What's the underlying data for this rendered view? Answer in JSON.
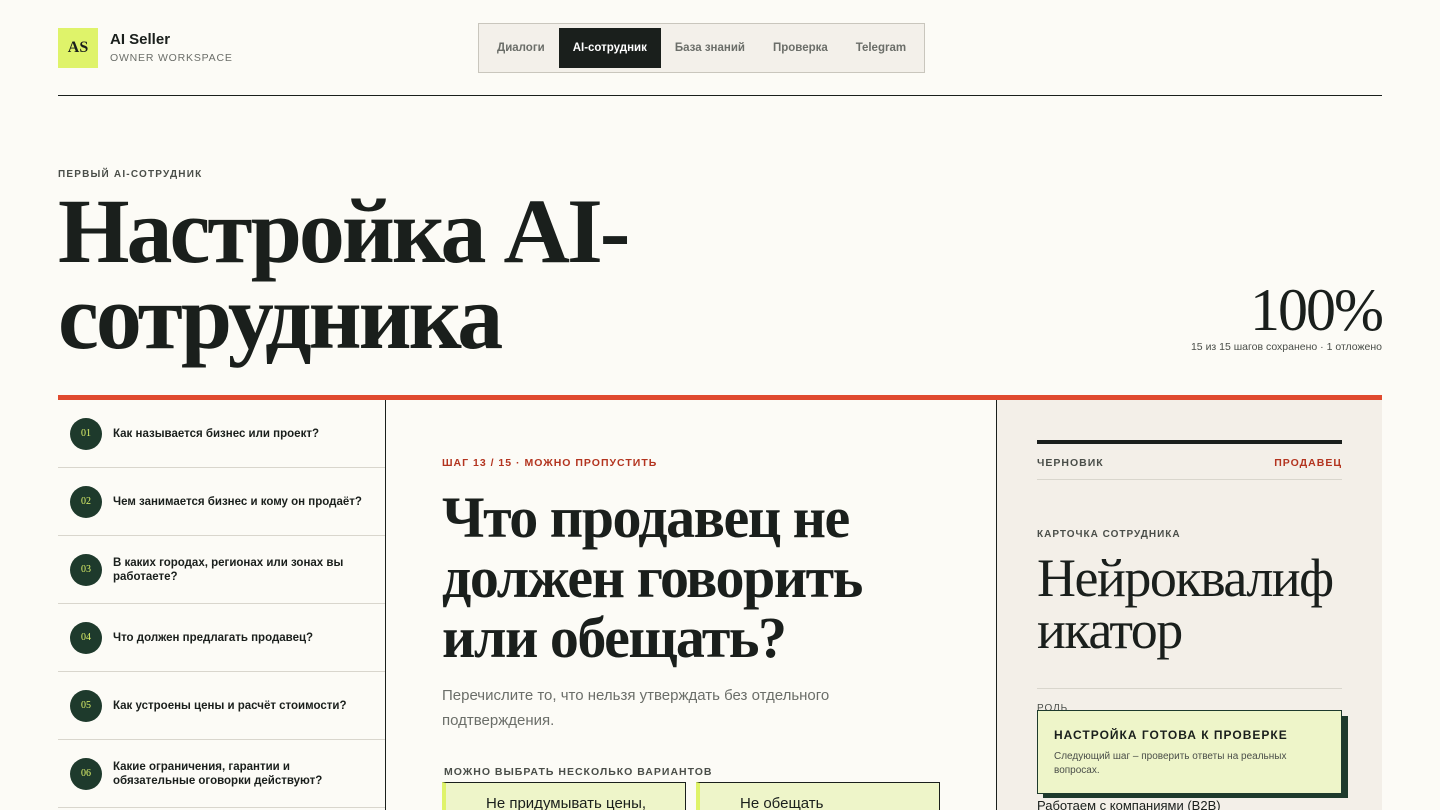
{
  "header": {
    "logo": "AS",
    "brand_name": "AI Seller",
    "brand_sub": "OWNER WORKSPACE",
    "nav": [
      {
        "label": "Диалоги",
        "active": false
      },
      {
        "label": "AI-сотрудник",
        "active": true
      },
      {
        "label": "База знаний",
        "active": false
      },
      {
        "label": "Проверка",
        "active": false
      },
      {
        "label": "Telegram",
        "active": false
      }
    ]
  },
  "hero": {
    "eyebrow": "ПЕРВЫЙ AI-СОТРУДНИК",
    "title": "Настройка AI-сотрудника",
    "progress_value": "100%",
    "progress_note": "15 из 15 шагов сохранено · 1 отложено"
  },
  "steps": [
    {
      "num": "01",
      "text": "Как называется бизнес или проект?"
    },
    {
      "num": "02",
      "text": "Чем занимается бизнес и кому он продаёт?"
    },
    {
      "num": "03",
      "text": "В каких городах, регионах или зонах вы работаете?"
    },
    {
      "num": "04",
      "text": "Что должен предлагать продавец?"
    },
    {
      "num": "05",
      "text": "Как устроены цены и расчёт стоимости?"
    },
    {
      "num": "06",
      "text": "Какие ограничения, гарантии и обязательные оговорки действуют?"
    }
  ],
  "question": {
    "meta": "ШАГ 13 / 15 · МОЖНО ПРОПУСТИТЬ",
    "title": "Что продавец не должен говорить или обещать?",
    "hint": "Перечислите то, что нельзя утверждать без отдельного подтверждения.",
    "multi_label": "МОЖНО ВЫБРАТЬ НЕСКОЛЬКО ВАРИАНТОВ",
    "options": [
      "Не придумывать цены,",
      "Не обещать"
    ]
  },
  "draft": {
    "label": "ЧЕРНОВИК",
    "role": "ПРОДАВЕЦ",
    "card_label": "КАРТОЧКА СОТРУДНИКА",
    "card_name": "Нейроквалификатор",
    "role_field": "РОЛЬ",
    "b2b": "Работаем с компаниями (B2B)"
  },
  "toast": {
    "title": "НАСТРОЙКА ГОТОВА К ПРОВЕРКЕ",
    "text": "Следующий шаг – проверить ответы на реальных вопросах."
  },
  "colors": {
    "accent_lime": "#dff36a",
    "accent_red": "#e04a2f",
    "dark_green": "#1e3a2c",
    "background": "#fcfbf6"
  }
}
